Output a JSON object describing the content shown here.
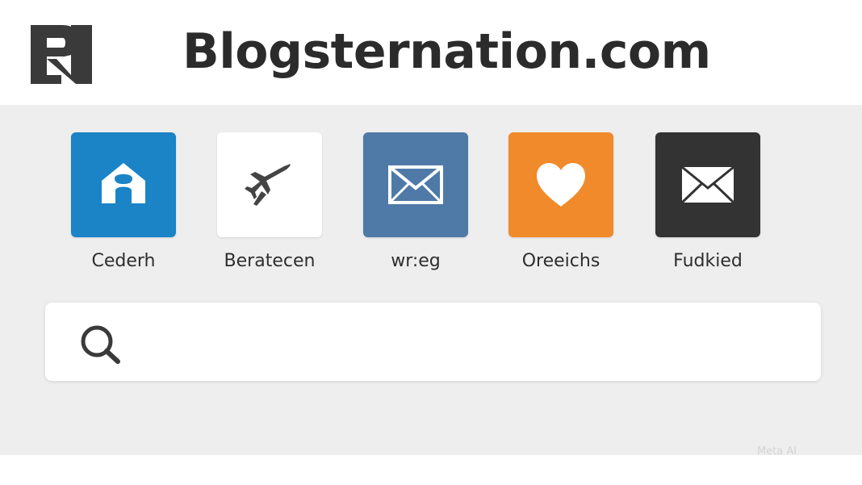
{
  "header": {
    "site_title": "Blogsternation.com",
    "logo_icon": "rn-monogram-logo-icon"
  },
  "apps": [
    {
      "label": "Cederh",
      "icon": "home-icon",
      "color": "#1b84c7"
    },
    {
      "label": "Beratecen",
      "icon": "airplane-icon",
      "color": "#ffffff"
    },
    {
      "label": "wr:eg",
      "icon": "mail-icon",
      "color": "#4f7aa8"
    },
    {
      "label": "Oreeichs",
      "icon": "heart-icon",
      "color": "#f08a2a"
    },
    {
      "label": "Fudkied",
      "icon": "mail-icon",
      "color": "#333333"
    }
  ],
  "search": {
    "placeholder": "",
    "value": "",
    "icon": "search-icon"
  },
  "watermark": {
    "text": "Meta AI"
  }
}
